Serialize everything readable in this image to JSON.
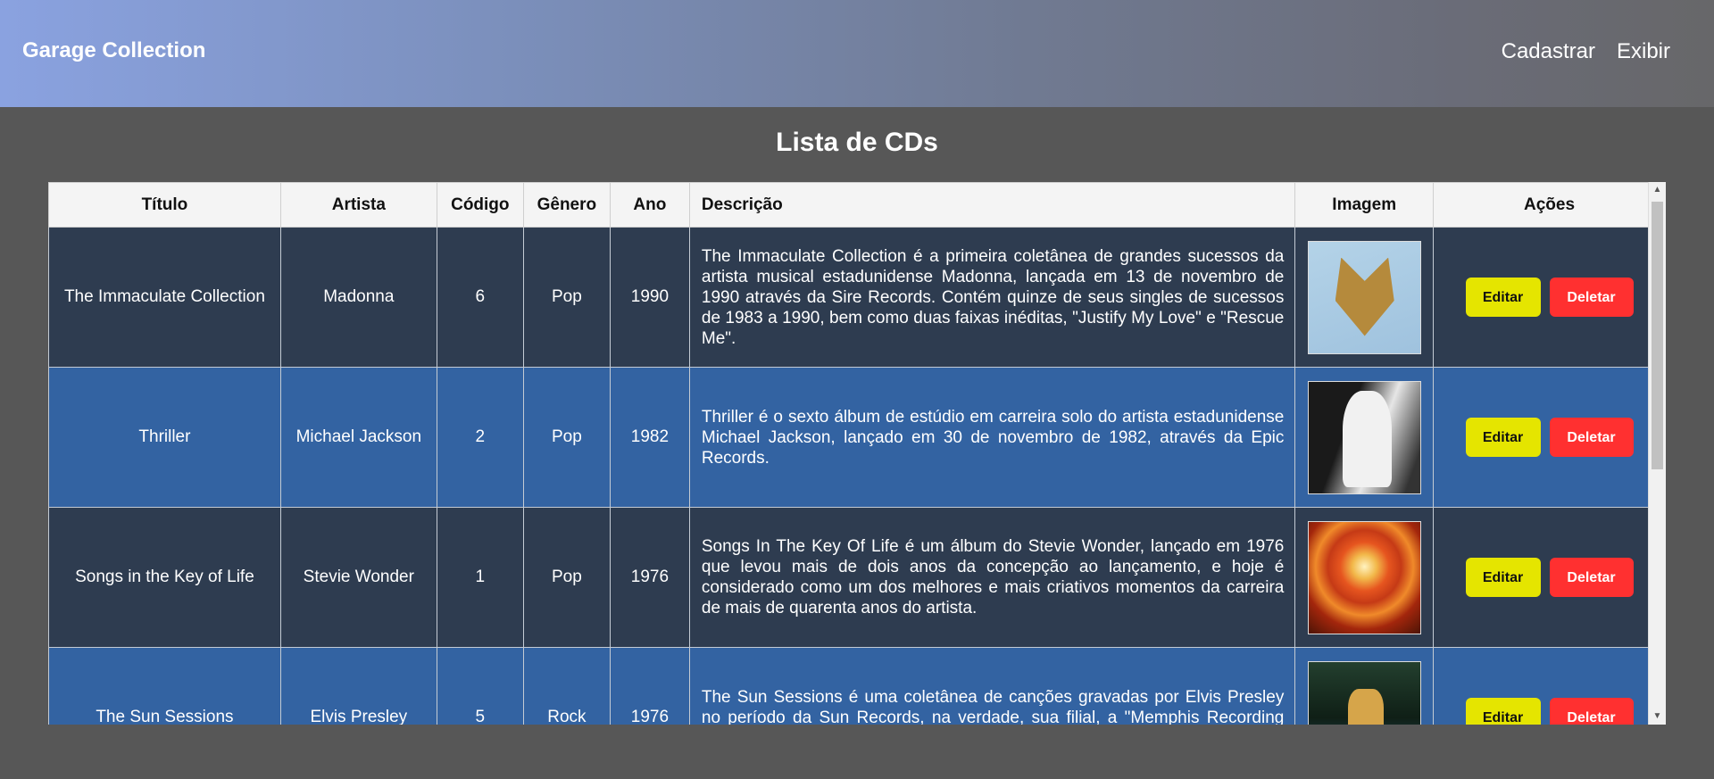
{
  "header": {
    "brand": "Garage Collection",
    "nav": [
      "Cadastrar",
      "Exibir"
    ]
  },
  "page_title": "Lista de CDs",
  "table": {
    "columns": [
      "Título",
      "Artista",
      "Código",
      "Gênero",
      "Ano",
      "Descrição",
      "Imagem",
      "Ações"
    ],
    "rows": [
      {
        "titulo": "The Immaculate Collection",
        "artista": "Madonna",
        "codigo": "6",
        "genero": "Pop",
        "ano": "1990",
        "descricao": "The Immaculate Collection é a primeira coletânea de grandes sucessos da artista musical estadunidense Madonna, lançada em 13 de novembro de 1990 através da Sire Records. Contém quinze de seus singles de sucessos de 1983 a 1990, bem como duas faixas inéditas, \"Justify My Love\" e \"Rescue Me\".",
        "image": "album-cover-immaculate"
      },
      {
        "titulo": "Thriller",
        "artista": "Michael Jackson",
        "codigo": "2",
        "genero": "Pop",
        "ano": "1982",
        "descricao": "Thriller é o sexto álbum de estúdio em carreira solo do artista estadunidense Michael Jackson, lançado em 30 de novembro de 1982, através da Epic Records.",
        "image": "album-cover-thriller"
      },
      {
        "titulo": "Songs in the Key of Life",
        "artista": "Stevie Wonder",
        "codigo": "1",
        "genero": "Pop",
        "ano": "1976",
        "descricao": "Songs In The Key Of Life é um álbum do Stevie Wonder, lançado em 1976 que levou mais de dois anos da concepção ao lançamento, e hoje é considerado como um dos melhores e mais criativos momentos da carreira de mais de quarenta anos do artista.",
        "image": "album-cover-songs-key-of-life"
      },
      {
        "titulo": "The Sun Sessions",
        "artista": "Elvis Presley",
        "codigo": "5",
        "genero": "Rock",
        "ano": "1976",
        "descricao": "The Sun Sessions é uma coletânea de canções gravadas por Elvis Presley no período da Sun Records, na verdade, sua filial, a \"Memphis Recording Service\" de Sam Phillips, onde Elvis começou sua carreira",
        "image": "album-cover-sun-sessions"
      }
    ],
    "actions": {
      "edit_label": "Editar",
      "delete_label": "Deletar"
    }
  },
  "colors": {
    "edit_button": "#e5e500",
    "delete_button": "#ff3030",
    "row_dark": "#2e3c50",
    "row_blue": "#3363a2",
    "page_background": "#575757"
  }
}
